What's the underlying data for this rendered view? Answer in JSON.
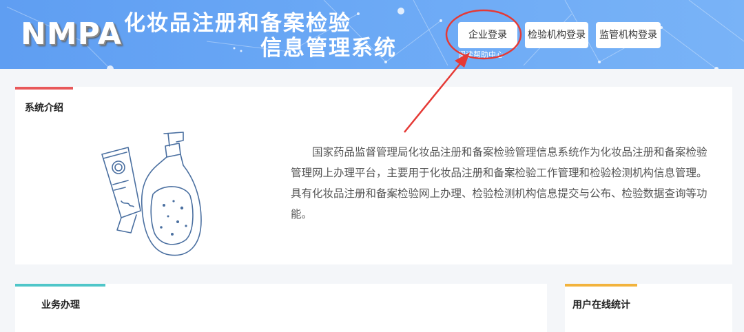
{
  "header": {
    "logo_text": "NMPA",
    "title_line1": "化妆品注册和备案检验",
    "title_line2": "信息管理系统",
    "buttons": {
      "enterprise_login": "企业登录",
      "institution_login": "检验机构登录",
      "regulator_login": "监管机构登录"
    },
    "help_link": "阅读帮助中心"
  },
  "intro": {
    "title": "系统介绍",
    "text": "国家药品监督管理局化妆品注册和备案检验管理信息系统作为化妆品注册和备案检验管理网上办理平台，主要用于化妆品注册和备案检验工作管理和检验检测机构信息管理。具有化妆品注册和备案检验网上办理、检验检测机构信息提交与公布、检验数据查询等功能。",
    "accent_color": "#e8585a"
  },
  "business": {
    "title": "业务办理",
    "accent_color": "#4fc6c9"
  },
  "online_stats": {
    "title": "用户在线统计",
    "accent_color": "#f2b33d"
  },
  "annotation_color": "#e53935"
}
